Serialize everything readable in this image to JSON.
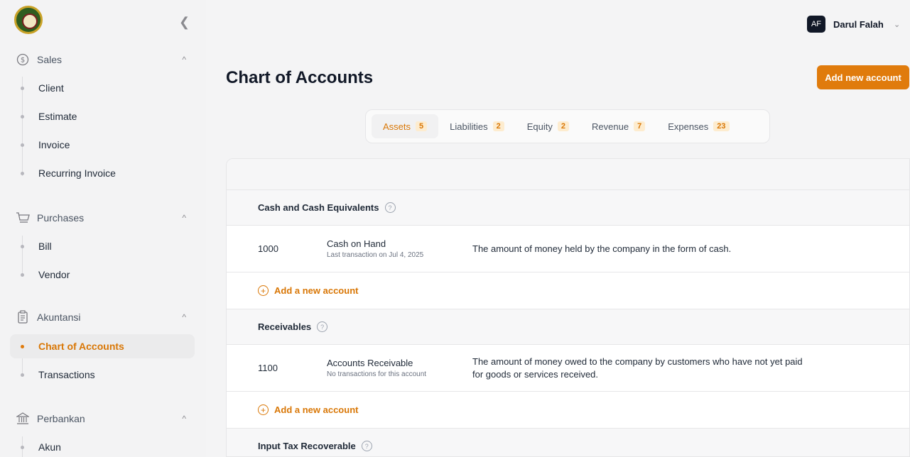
{
  "sidebar": {
    "logo_icon": "company-seal-logo",
    "collapse_icon": "chevron-left-icon",
    "groups": [
      {
        "label": "Sales",
        "icon": "dollar-circle-icon",
        "items": [
          {
            "label": "Client"
          },
          {
            "label": "Estimate"
          },
          {
            "label": "Invoice"
          },
          {
            "label": "Recurring Invoice"
          }
        ]
      },
      {
        "label": "Purchases",
        "icon": "cart-icon",
        "items": [
          {
            "label": "Bill"
          },
          {
            "label": "Vendor"
          }
        ]
      },
      {
        "label": "Akuntansi",
        "icon": "ledger-icon",
        "items": [
          {
            "label": "Chart of Accounts",
            "active": true
          },
          {
            "label": "Transactions"
          }
        ]
      },
      {
        "label": "Perbankan",
        "icon": "bank-icon",
        "items": [
          {
            "label": "Akun"
          }
        ]
      }
    ]
  },
  "header": {
    "avatar_initials": "AF",
    "user_name": "Darul Falah"
  },
  "main": {
    "title": "Chart of Accounts",
    "add_button": "Add new account",
    "tabs": [
      {
        "label": "Assets",
        "count": "5",
        "active": true
      },
      {
        "label": "Liabilities",
        "count": "2"
      },
      {
        "label": "Equity",
        "count": "2"
      },
      {
        "label": "Revenue",
        "count": "7"
      },
      {
        "label": "Expenses",
        "count": "23"
      }
    ],
    "sections": [
      {
        "title": "Cash and Cash Equivalents",
        "account": {
          "code": "1000",
          "name": "Cash on Hand",
          "sub": "Last transaction on Jul 4, 2025",
          "description": "The amount of money held by the company in the form of cash."
        },
        "add_label": "Add a new account"
      },
      {
        "title": "Receivables",
        "account": {
          "code": "1100",
          "name": "Accounts Receivable",
          "sub": "No transactions for this account",
          "description": "The amount of money owed to the company by customers who have not yet paid for goods or services received."
        },
        "add_label": "Add a new account"
      },
      {
        "title": "Input Tax Recoverable"
      }
    ]
  },
  "colors": {
    "accent": "#e07b0c",
    "sidebar_bg": "#f3f3f4",
    "panel_bg": "#ffffff"
  }
}
